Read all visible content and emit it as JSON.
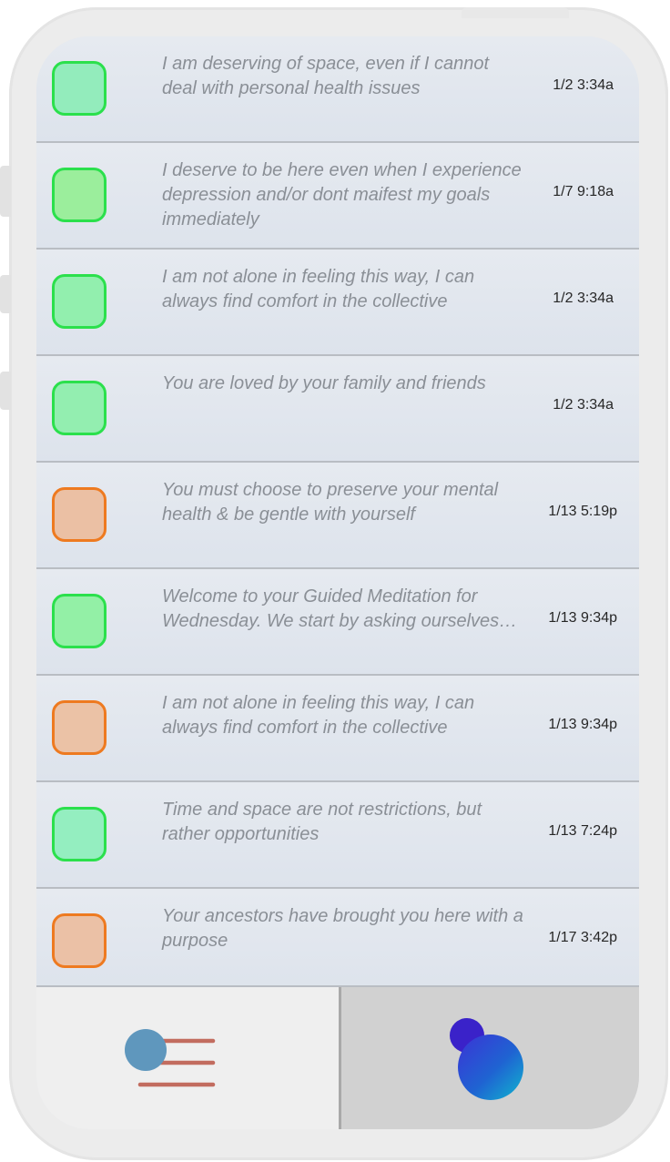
{
  "feed": {
    "items": [
      {
        "message": "I am deserving of space, even if I cannot deal with personal health issues",
        "time": "1/2 3:34a",
        "mood": "good",
        "mood_fill": "#93ecbc"
      },
      {
        "message": "I deserve to be here even when I experience depression and/or dont maifest my goals immediately",
        "time": "1/7 9:18a",
        "mood": "good",
        "mood_fill": "#9bee9c"
      },
      {
        "message": "I am not alone in feeling this way, I can always find comfort in the collective",
        "time": "1/2 3:34a",
        "mood": "good",
        "mood_fill": "#92efae"
      },
      {
        "message": "You are loved by your family and friends",
        "time": "1/2 3:34a",
        "mood": "good",
        "mood_fill": "#93eeb0"
      },
      {
        "message": "You must choose to preserve your mental health & be gentle with yourself",
        "time": "1/13 5:19p",
        "mood": "bad",
        "mood_fill": "#ebc0a4"
      },
      {
        "message": "Welcome to your Guided Meditation for Wednesday. We start by asking ourselves…",
        "time": "1/13 9:34p",
        "mood": "good",
        "mood_fill": "#93f0a6"
      },
      {
        "message": "I am not alone in feeling this way, I can always find comfort in the collective",
        "time": "1/13 9:34p",
        "mood": "bad",
        "mood_fill": "#ebc2a6"
      },
      {
        "message": "Time and space are not restrictions, but rather opportunities",
        "time": "1/13 7:24p",
        "mood": "good",
        "mood_fill": "#94eec0"
      },
      {
        "message": "Your ancestors have brought you here with a purpose",
        "time": "1/17 3:42p",
        "mood": "bad",
        "mood_fill": "#ebc1a6"
      }
    ]
  },
  "tabbar": {
    "tabs": [
      {
        "icon": "list-menu-icon",
        "active": true
      },
      {
        "icon": "bubbles-icon",
        "active": false
      }
    ]
  },
  "colors": {
    "good_border": "#2be04c",
    "bad_border": "#ee7a20",
    "message_text": "#8a8f96",
    "list_icon_lines": "#c26c5f",
    "list_icon_dot": "#5f97bd"
  }
}
